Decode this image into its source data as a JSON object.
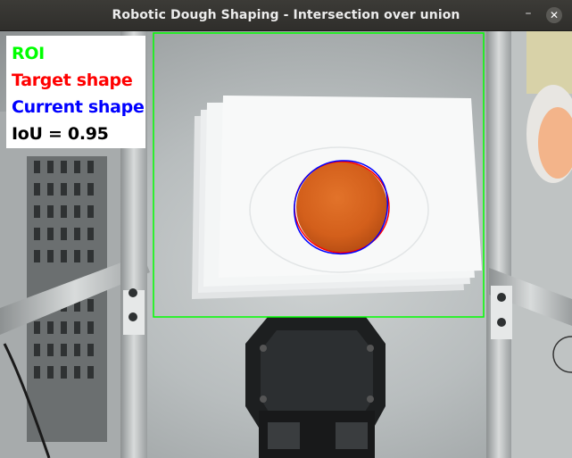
{
  "window": {
    "title": "Robotic Dough Shaping - Intersection over union",
    "minimize_icon": "minimize-icon",
    "close_icon": "close-icon",
    "minimize_glyph": "–",
    "close_glyph": "✕"
  },
  "overlay": {
    "roi_label": "ROI",
    "target_label": "Target shape",
    "current_label": "Current shape",
    "iou_label": "IoU = 0.95"
  },
  "colors": {
    "roi": "#00ff00",
    "target": "#ff0000",
    "current": "#0000ff",
    "dough": "#d9641c"
  }
}
